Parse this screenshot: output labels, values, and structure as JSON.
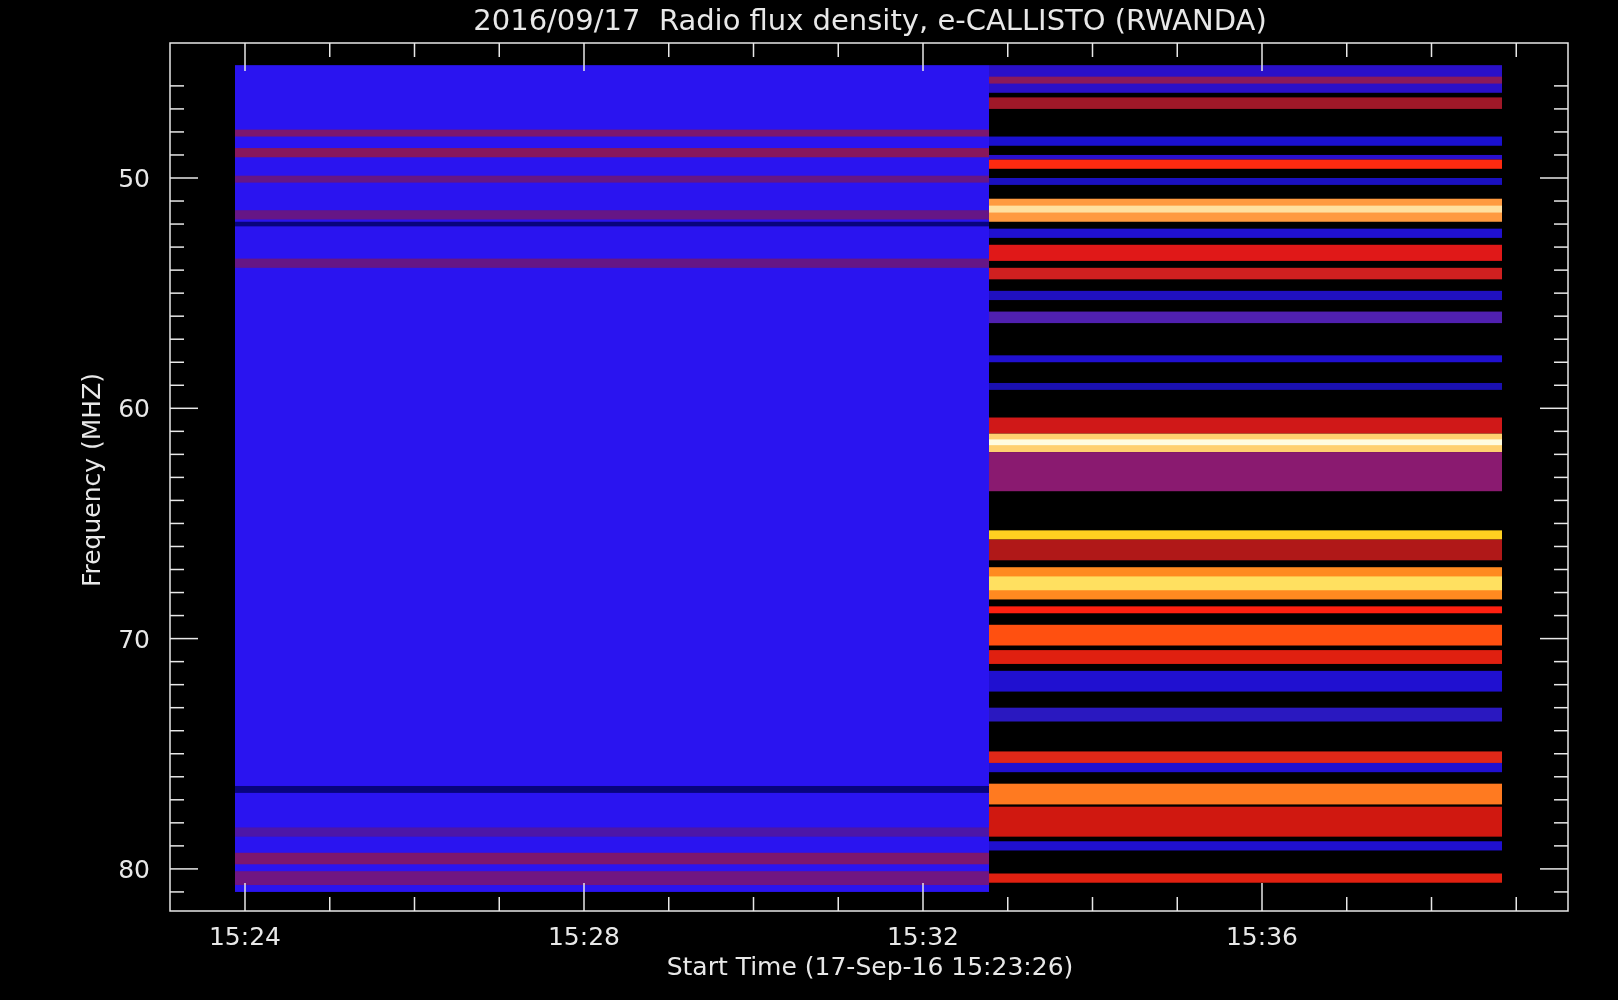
{
  "title": "2016/09/17  Radio flux density, e-CALLISTO (RWANDA)",
  "y_axis": {
    "label": "Frequency (MHZ)",
    "ticks": [
      "50",
      "60",
      "70",
      "80"
    ]
  },
  "x_axis": {
    "label": "Start Time (17-Sep-16 15:23:26)",
    "ticks": [
      "15:24",
      "15:28",
      "15:32",
      "15:36"
    ]
  }
}
